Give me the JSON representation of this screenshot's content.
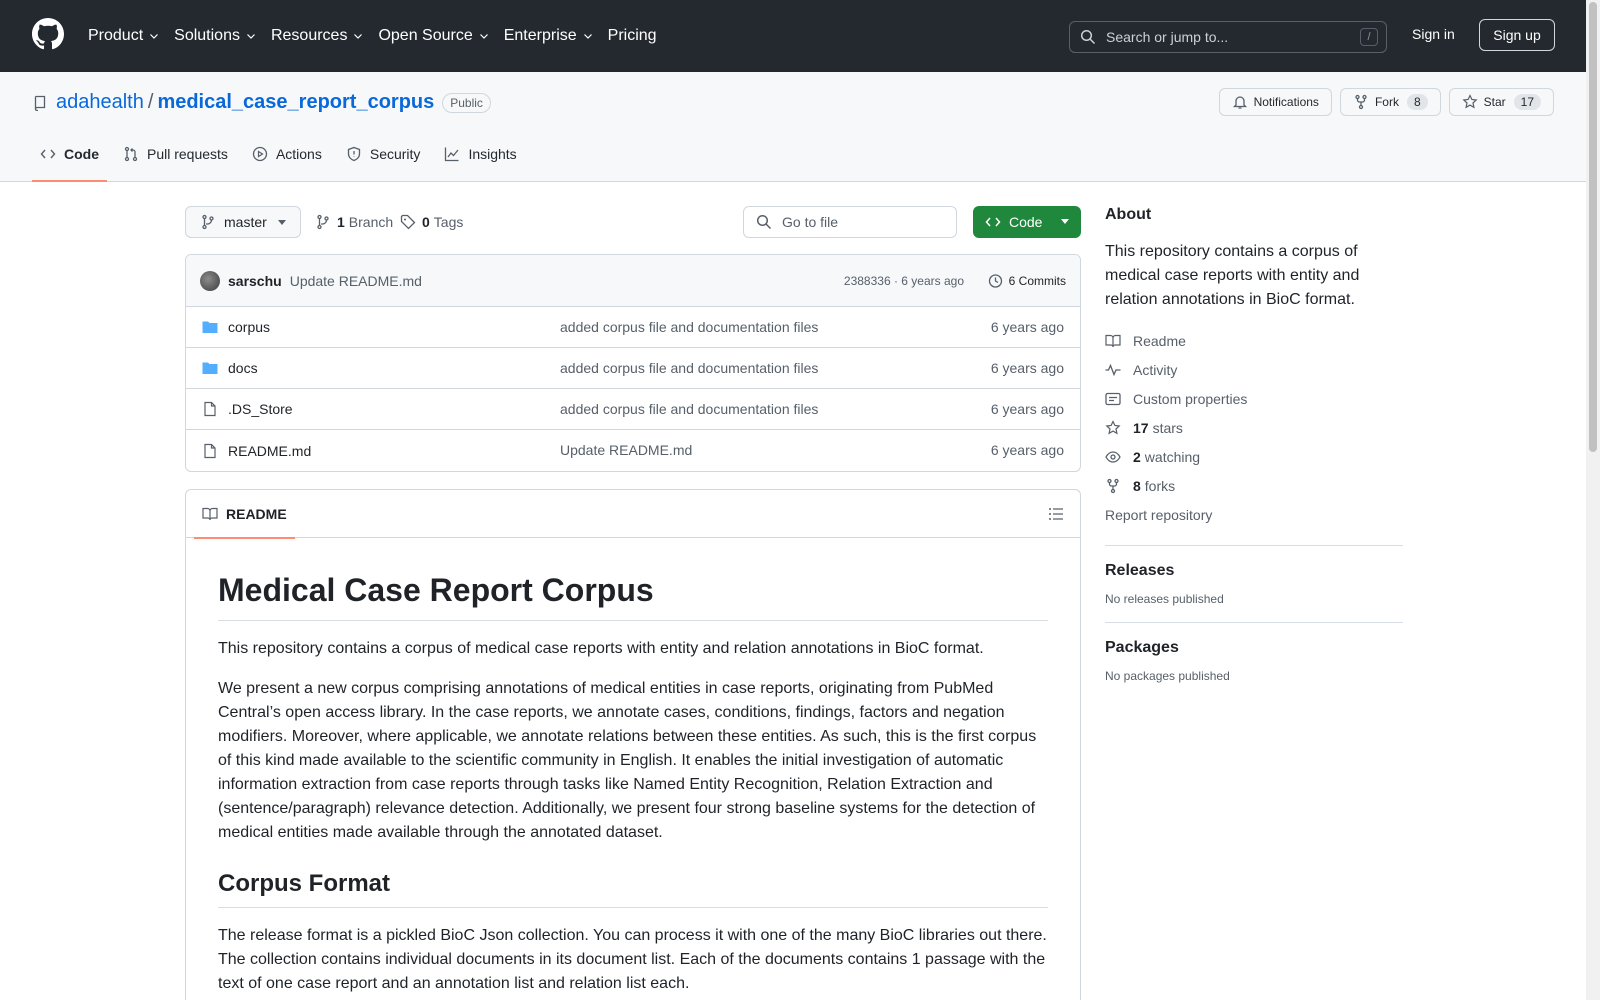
{
  "header": {
    "nav": [
      {
        "label": "Product",
        "has_menu": true
      },
      {
        "label": "Solutions",
        "has_menu": true
      },
      {
        "label": "Resources",
        "has_menu": true
      },
      {
        "label": "Open Source",
        "has_menu": true
      },
      {
        "label": "Enterprise",
        "has_menu": true
      },
      {
        "label": "Pricing",
        "has_menu": false
      }
    ],
    "search_placeholder": "Search or jump to...",
    "search_shortcut": "/",
    "sign_in": "Sign in",
    "sign_up": "Sign up"
  },
  "repo": {
    "owner": "adahealth",
    "separator": "/",
    "name": "medical_case_report_corpus",
    "visibility": "Public",
    "notifications_label": "Notifications",
    "fork_label": "Fork",
    "fork_count": "8",
    "star_label": "Star",
    "star_count": "17"
  },
  "tabs": [
    {
      "label": "Code",
      "icon": "code-icon",
      "active": true
    },
    {
      "label": "Pull requests",
      "icon": "pull-request-icon",
      "active": false
    },
    {
      "label": "Actions",
      "icon": "play-icon",
      "active": false
    },
    {
      "label": "Security",
      "icon": "shield-icon",
      "active": false
    },
    {
      "label": "Insights",
      "icon": "graph-icon",
      "active": false
    }
  ],
  "toolbar": {
    "branch": "master",
    "branch_count": "1",
    "branch_label": "Branch",
    "tag_count": "0",
    "tag_label": "Tags",
    "goto_placeholder": "Go to file",
    "code_button": "Code"
  },
  "latest_commit": {
    "author": "sarschu",
    "message": "Update README.md",
    "meta": "2388336 · 6 years ago",
    "commits_label": "6 Commits"
  },
  "files": [
    {
      "name": "corpus",
      "type": "folder",
      "message": "added corpus file and documentation files",
      "date": "6 years ago"
    },
    {
      "name": "docs",
      "type": "folder",
      "message": "added corpus file and documentation files",
      "date": "6 years ago"
    },
    {
      "name": ".DS_Store",
      "type": "file",
      "message": "added corpus file and documentation files",
      "date": "6 years ago"
    },
    {
      "name": "README.md",
      "type": "file",
      "message": "Update README.md",
      "date": "6 years ago"
    }
  ],
  "readme": {
    "tab_label": "README",
    "h1": "Medical Case Report Corpus",
    "p1": "This repository contains a corpus of medical case reports with entity and relation annotations in BioC format.",
    "p2": "We present a new corpus comprising annotations of medical entities in case reports, originating from PubMed Central’s open access library. In the case reports, we annotate cases, conditions, findings, factors and negation modifiers. Moreover, where applicable, we annotate relations between these entities. As such, this is the first corpus of this kind made available to the scientific community in English. It enables the initial investigation of automatic information extraction from case reports through tasks like Named Entity Recognition, Relation Extraction and (sentence/paragraph) relevance detection. Additionally, we present four strong baseline systems for the detection of medical entities made available through the annotated dataset.",
    "h2": "Corpus Format",
    "p3": "The release format is a pickled BioC Json collection. You can process it with one of the many BioC libraries out there. The collection contains individual documents in its document list. Each of the documents contains 1 passage with the text of one case report and an annotation list and relation list each."
  },
  "sidebar": {
    "about_title": "About",
    "about_desc": "This repository contains a corpus of medical case reports with entity and relation annotations in BioC format.",
    "readme": "Readme",
    "activity": "Activity",
    "custom_properties": "Custom properties",
    "stars_count": "17",
    "stars_label": "stars",
    "watching_count": "2",
    "watching_label": "watching",
    "forks_count": "8",
    "forks_label": "forks",
    "report": "Report repository",
    "releases_title": "Releases",
    "releases_empty": "No releases published",
    "packages_title": "Packages",
    "packages_empty": "No packages published"
  },
  "colors": {
    "header_bg": "#24292f",
    "link": "#0969da",
    "primary_button": "#1f883d",
    "active_tab_underline": "#fd8c73",
    "folder_icon": "#54aeff"
  }
}
